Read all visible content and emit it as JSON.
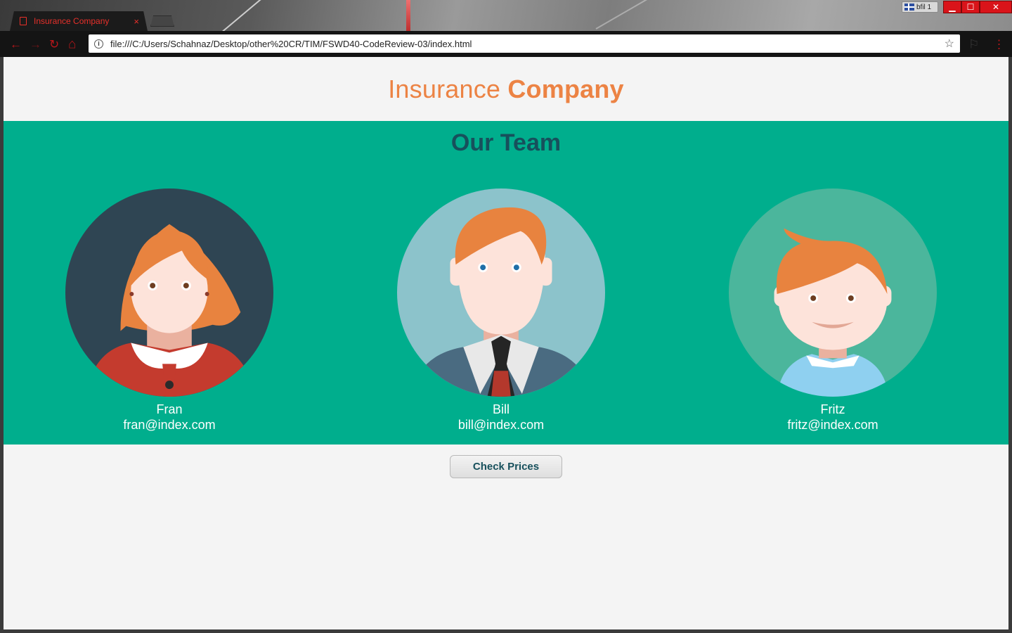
{
  "browser": {
    "tab_title": "Insurance Company",
    "tab_close": "×",
    "url": "file:///C:/Users/Schahnaz/Desktop/other%20CR/TIM/FSWD40-CodeReview-03/index.html",
    "profile_label": "bfil 1",
    "info_icon": "i",
    "icons": {
      "back": "←",
      "forward": "→",
      "reload": "↻",
      "home": "⌂",
      "star": "☆",
      "bookmark": "⚐",
      "menu": "⋮",
      "minimize": "▁",
      "maximize": "☐",
      "close": "✕"
    }
  },
  "page": {
    "brand": {
      "light": "Insurance ",
      "bold": "Company"
    },
    "team_title": "Our Team",
    "members": [
      {
        "name": "Fran",
        "email": "fran@index.com"
      },
      {
        "name": "Bill",
        "email": "bill@index.com"
      },
      {
        "name": "Fritz",
        "email": "fritz@index.com"
      }
    ],
    "cta_label": "Check Prices"
  },
  "colors": {
    "accent_orange": "#ec8344",
    "team_green": "#00ae8d",
    "title_navy": "#17505c",
    "chrome_red": "#d9141a"
  }
}
